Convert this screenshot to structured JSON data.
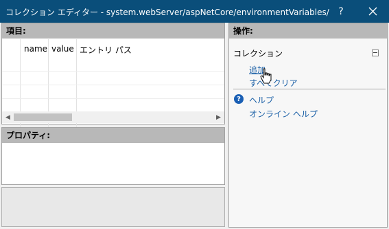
{
  "window": {
    "title": "コレクション エディター - system.webServer/aspNetCore/environmentVariables/",
    "help_label": "?"
  },
  "items_panel": {
    "header": "項目:",
    "columns": [
      "name",
      "value",
      "エントリ パス"
    ]
  },
  "properties_panel": {
    "header": "プロパティ:"
  },
  "actions_panel": {
    "header": "操作:",
    "section_title": "コレクション",
    "links": {
      "add": "追加",
      "clear_all": "すべてクリア"
    },
    "help_links": {
      "help": "ヘルプ",
      "online_help": "オンライン ヘルプ"
    }
  },
  "icons": {
    "close": "close-icon",
    "help": "help-icon",
    "collapse": "collapse-icon",
    "scroll_left": "scroll-left-icon",
    "scroll_right": "scroll-right-icon",
    "pointer": "hand-pointer-icon"
  },
  "colors": {
    "titlebar": "#0a4e7a",
    "header": "#b8b8b8",
    "link": "#1a5fa6"
  }
}
